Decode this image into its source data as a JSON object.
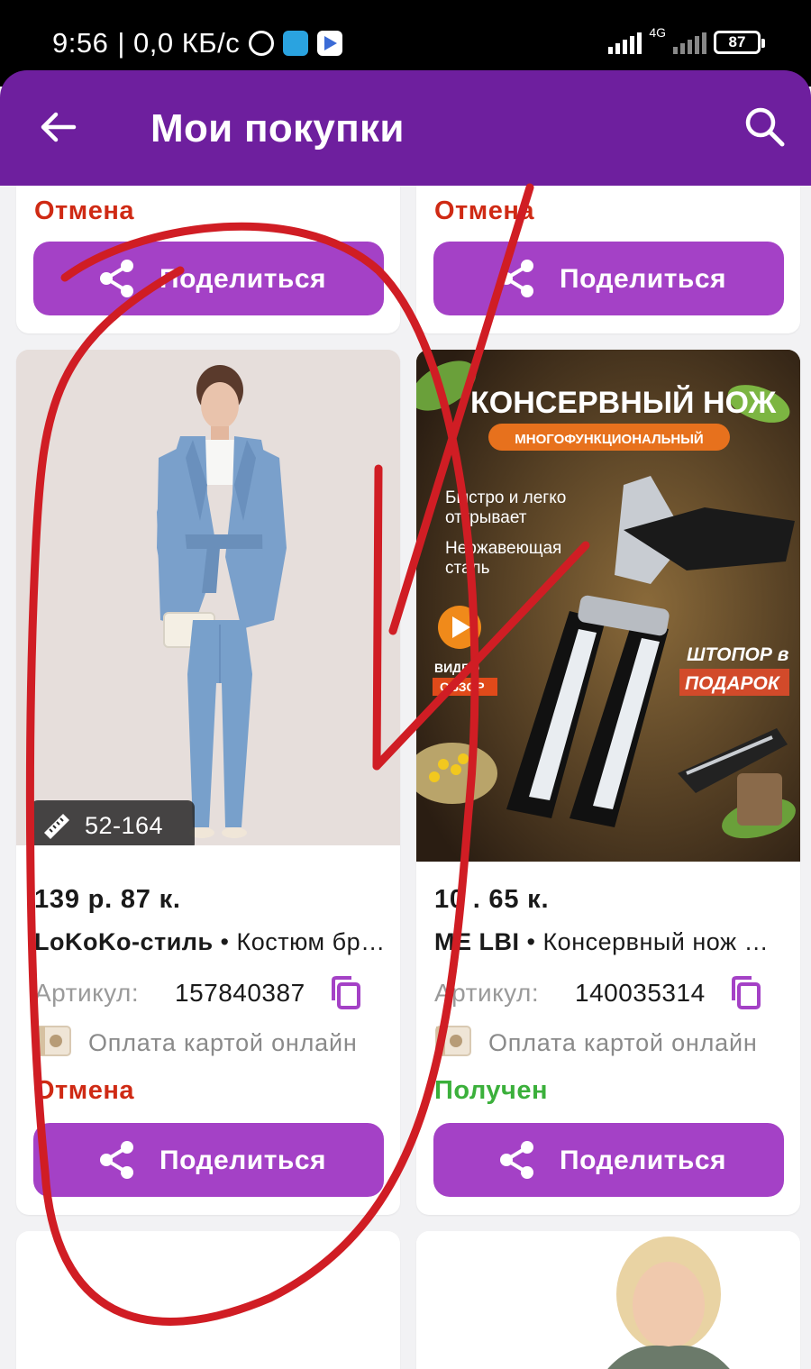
{
  "status_bar": {
    "time": "9:56",
    "speed": "| 0,0 КБ/с",
    "network": "4G",
    "battery": "87"
  },
  "app_bar": {
    "title": "Мои покупки"
  },
  "colors": {
    "app_bar": "#6e1f9e",
    "share_button": "#a441c6",
    "status_cancel": "#cf2a14",
    "status_received": "#3bb03b",
    "annotation": "#d01d24"
  },
  "top_cards": [
    {
      "status": "Отмена",
      "status_kind": "cancel",
      "share_label": "Поделиться"
    },
    {
      "status": "Отмена",
      "status_kind": "cancel",
      "share_label": "Поделиться"
    }
  ],
  "products": [
    {
      "image": "woman-blue-suit-photo",
      "size_badge": "52-164",
      "price": "139 р. 87 к.",
      "brand": "LoKoKo-стиль",
      "name": " • Костюм бр…",
      "article_label": "Артикул:",
      "article": "157840387",
      "payment": "Оплата картой онлайн",
      "status": "Отмена",
      "status_kind": "cancel",
      "share_label": "Поделиться"
    },
    {
      "image": "can-opener-ad",
      "image_text": {
        "headline": "КОНСЕРВНЫЙ НОЖ",
        "subheadline": "МНОГОФУНКЦИОНАЛЬНЫЙ",
        "feature_1_line_1": "Быстро и легко",
        "feature_1_line_2": "открывает",
        "feature_2_line_1": "Нержавеющая",
        "feature_2_line_2": "сталь",
        "gift_line_1": "ШТОПОР в",
        "gift_line_2": "ПОДАРОК",
        "video_1": "ВИДЕО",
        "video_2": "ОБЗОР"
      },
      "price": "10 . 65 к.",
      "brand": "ME LBI",
      "name": " • Консервный нож …",
      "article_label": "Артикул:",
      "article": "140035314",
      "payment": "Оплата картой онлайн",
      "status": "Получен",
      "status_kind": "received",
      "share_label": "Поделиться"
    }
  ]
}
